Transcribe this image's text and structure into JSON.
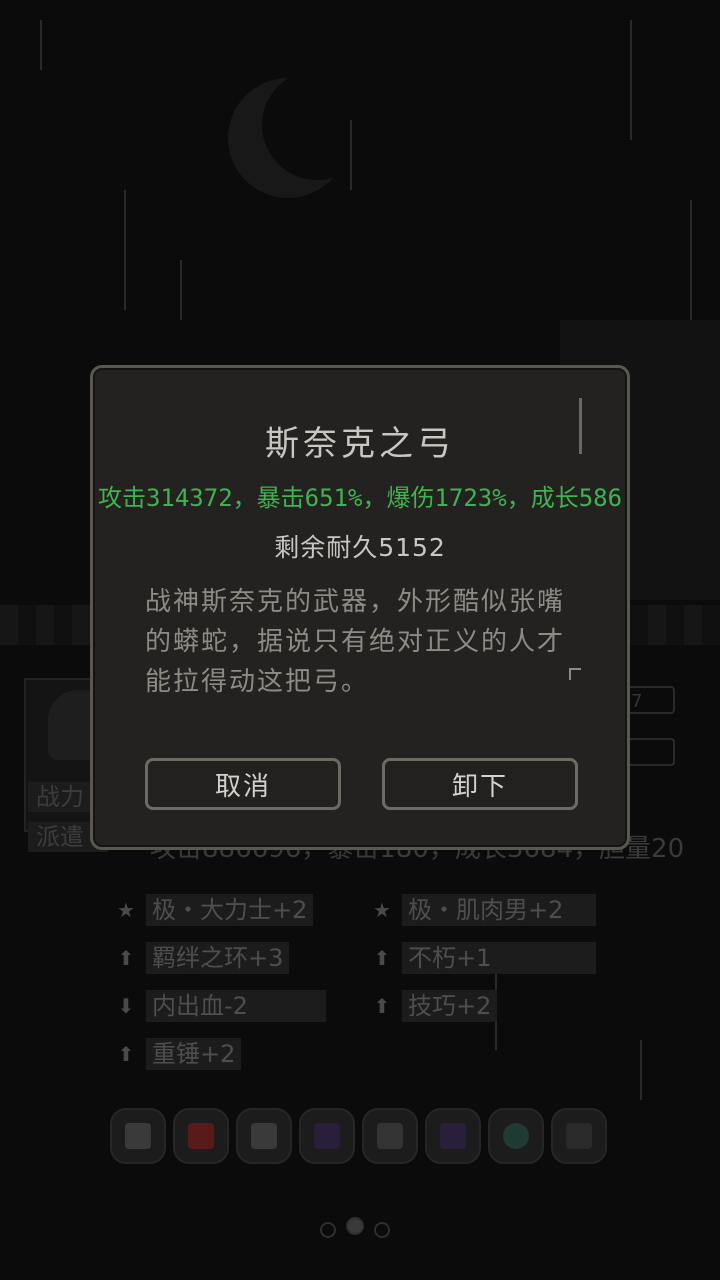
{
  "dialog": {
    "title": "斯奈克之弓",
    "stats": "攻击314372，暴击651%，爆伤1723%，成长586",
    "durability": "剩余耐久5152",
    "description": "战神斯奈克的武器，外形酷似张嘴的蟒蛇，据说只有绝对正义的人才能拉得动这把弓。",
    "cancel_label": "取消",
    "unequip_label": "卸下"
  },
  "background": {
    "tags": [
      "战力",
      "派遣"
    ],
    "stat_bar_values": [
      "7",
      ""
    ],
    "stats_line": "攻击886696，暴击180，成长3684，胆量20",
    "traits": [
      {
        "icon": "star-icon",
        "label": "极・大力士+2"
      },
      {
        "icon": "star-icon",
        "label": "极・肌肉男+2"
      },
      {
        "icon": "arrow-up-icon",
        "label": "羁绊之环+3"
      },
      {
        "icon": "arrow-up-icon",
        "label": "不朽+1"
      },
      {
        "icon": "arrow-down-icon",
        "label": "内出血-2"
      },
      {
        "icon": "arrow-up-icon",
        "label": "技巧+2"
      },
      {
        "icon": "arrow-up-icon",
        "label": "重锤+2"
      }
    ],
    "equipment_icons": [
      "sword-icon",
      "helmet-icon",
      "glove-icon",
      "boot-icon",
      "cloak-icon",
      "gem-icon",
      "drop-icon",
      "slot-icon"
    ],
    "equipment_colors": [
      "#3a3a3a",
      "#5a1a1a",
      "#3a3a3a",
      "#2a1f3a",
      "#333333",
      "#2a1f3a",
      "#1f3a33",
      "#2a2a2a"
    ],
    "page_indicator": {
      "current": 2,
      "total": 3
    }
  },
  "colors": {
    "stats_green": "#3fb34f",
    "dialog_bg": "#242220",
    "dialog_border": "#5a5650"
  }
}
